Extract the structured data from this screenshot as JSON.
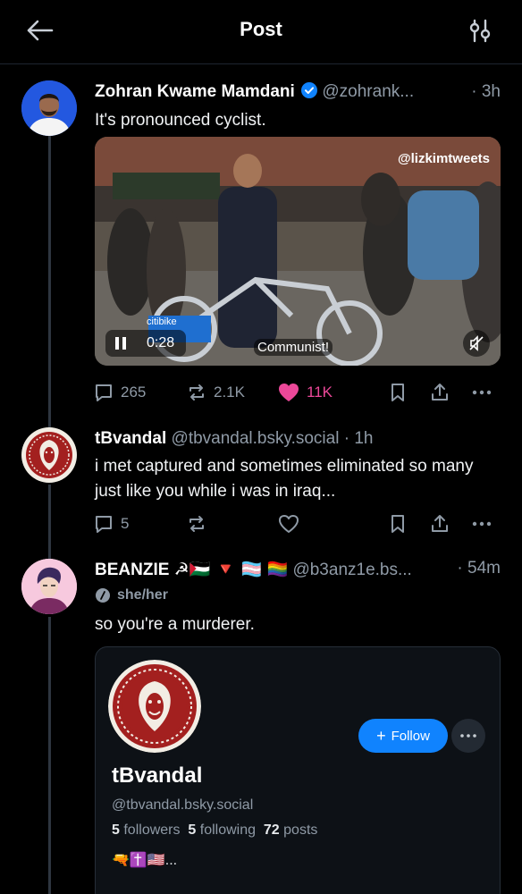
{
  "header": {
    "title": "Post"
  },
  "colors": {
    "background": "#000000",
    "accent": "#1083fe",
    "like": "#ec4899",
    "muted": "#8f9aa6"
  },
  "icons": [
    "back-arrow-icon",
    "tune-icon",
    "verified-icon",
    "reply-icon",
    "repost-icon",
    "heart-icon",
    "bookmark-icon",
    "share-icon",
    "more-icon",
    "pause-icon",
    "mute-icon",
    "pronoun-icon"
  ],
  "posts": [
    {
      "name": "Zohran Kwame Mamdani",
      "verified": true,
      "handle": "@zohrank...",
      "time": "· 3h",
      "text": "It's pronounced cyclist.",
      "video": {
        "watermark": "@lizkimtweets",
        "time": "0:28",
        "caption": "Communist!",
        "bike_label": "citibike"
      },
      "stats": {
        "replies": "265",
        "reposts": "2.1K",
        "likes": "11K"
      }
    },
    {
      "name": "tBvandal",
      "handle": "@tbvandal.bsky.social",
      "time": "· 1h",
      "text": "i met captured and sometimes eliminated so many just like you while i was in iraq...",
      "stats": {
        "replies": "5"
      }
    },
    {
      "name": "BEANZIE ☭🇵🇸 🔻 🏳️‍⚧️ 🏳️‍🌈",
      "handle": "@b3anz1e.bs...",
      "time": "· 54m",
      "pronouns": "she/her",
      "text": "so you're a murderer.",
      "embed": {
        "name": "tBvandal",
        "handle": "@tbvandal.bsky.social",
        "followers_count": "5",
        "followers_label": "followers",
        "following_count": "5",
        "following_label": "following",
        "posts_count": "72",
        "posts_label": "posts",
        "follow_label": "Follow",
        "bio_emojis": "🔫✝️🇺🇸..."
      }
    }
  ]
}
